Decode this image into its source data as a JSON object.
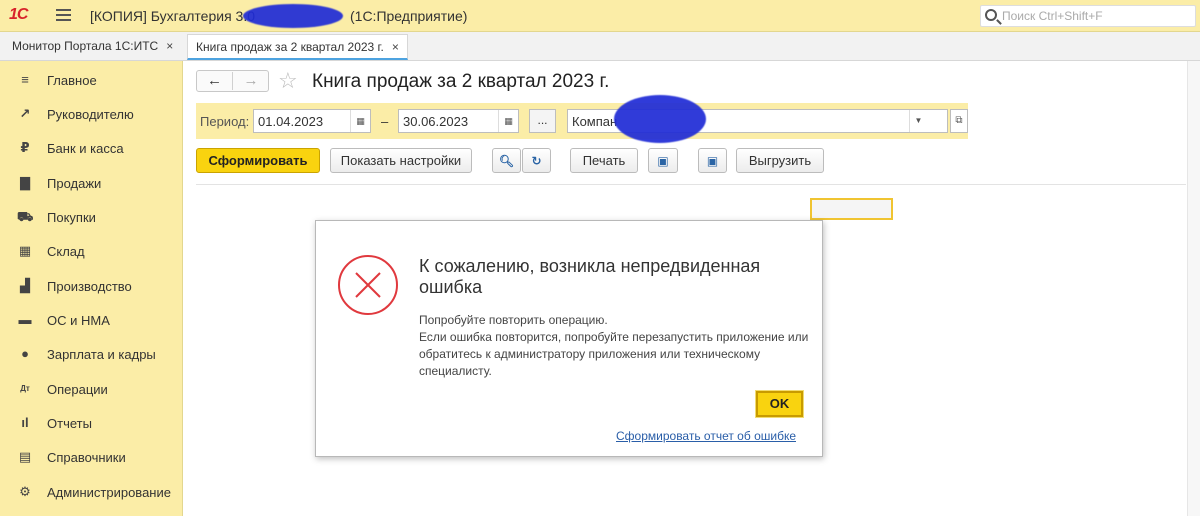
{
  "titlebar": {
    "logo": "1С",
    "title": "[КОПИЯ] Бухгалтерия 3.0",
    "subtitle": "(1С:Предприятие)",
    "search_placeholder": "Поиск Ctrl+Shift+F"
  },
  "tabs": [
    {
      "label": "Монитор Портала 1С:ИТС",
      "close": "×"
    },
    {
      "label": "Книга продаж за 2 квартал 2023 г.",
      "close": "×"
    }
  ],
  "sidebar": {
    "items": [
      {
        "label": "Главное",
        "icon": "menu-lines-icon",
        "glyph": "≡"
      },
      {
        "label": "Руководителю",
        "icon": "trend-icon",
        "glyph": "↗"
      },
      {
        "label": "Банк и касса",
        "icon": "ruble-coin-icon",
        "glyph": "₽"
      },
      {
        "label": "Продажи",
        "icon": "shopping-bag-icon",
        "glyph": "▇"
      },
      {
        "label": "Покупки",
        "icon": "cart-icon",
        "glyph": "⛟"
      },
      {
        "label": "Склад",
        "icon": "warehouse-icon",
        "glyph": "▦"
      },
      {
        "label": "Производство",
        "icon": "factory-icon",
        "glyph": "▟"
      },
      {
        "label": "ОС и НМА",
        "icon": "truck-icon",
        "glyph": "▬"
      },
      {
        "label": "Зарплата и кадры",
        "icon": "person-icon",
        "glyph": "●"
      },
      {
        "label": "Операции",
        "icon": "debit-credit-icon",
        "glyph": "Дт"
      },
      {
        "label": "Отчеты",
        "icon": "bar-chart-icon",
        "glyph": "ıl"
      },
      {
        "label": "Справочники",
        "icon": "books-icon",
        "glyph": "▤"
      },
      {
        "label": "Администрирование",
        "icon": "gear-icon",
        "glyph": "⚙"
      }
    ]
  },
  "document": {
    "title": "Книга продаж за 2 квартал 2023 г.",
    "back": "←",
    "forward": "→",
    "star": "☆"
  },
  "period": {
    "label": "Период:",
    "from": "01.04.2023",
    "to": "30.06.2023",
    "dash": "–",
    "dots": "...",
    "company": "Компан"
  },
  "toolbar": {
    "generate": "Сформировать",
    "settings": "Показать настройки",
    "print": "Печать",
    "export": "Выгрузить"
  },
  "error_dialog": {
    "title": "К сожалению, возникла непредвиденная ошибка",
    "line1": "Попробуйте повторить операцию.",
    "line2": "Если ошибка повторится, попробуйте перезапустить приложение или обратитесь к администратору приложения или техническому специалисту.",
    "ok": "OK",
    "report_link": "Сформировать отчет об ошибке"
  },
  "colors": {
    "accent_yellow": "#f9d30f",
    "panel_yellow": "#fbeda7",
    "error_red": "#e0393e",
    "link_blue": "#2a5ea8"
  }
}
